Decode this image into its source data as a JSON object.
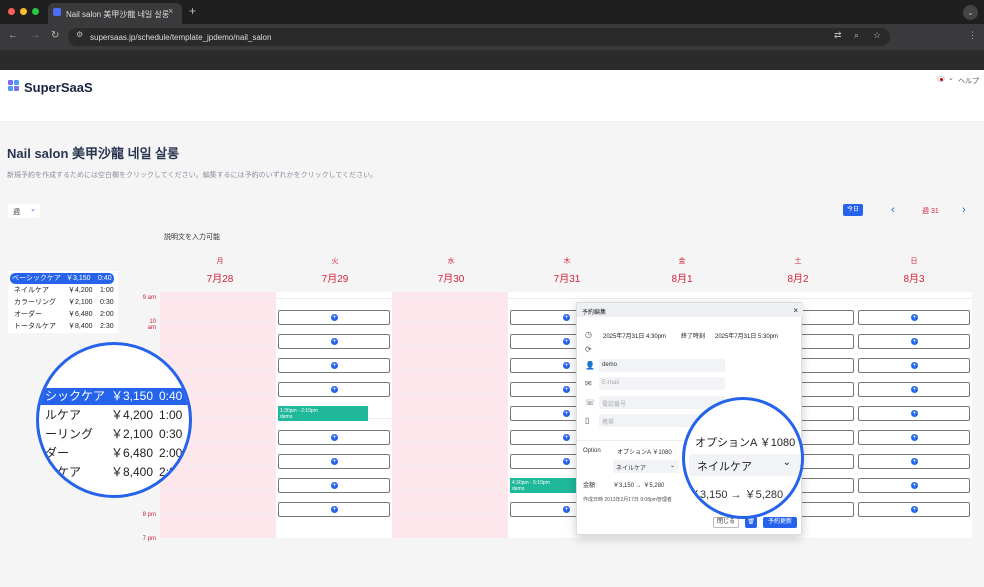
{
  "browser": {
    "tab_title": "Nail salon 美甲沙龍 네일 살롱",
    "tab_close": "×",
    "new_tab": "+",
    "url": "supersaas.jp/schedule/template_jpdemo/nail_salon",
    "menu": "⌄"
  },
  "header": {
    "brand": "SuperSaaS",
    "help": "ヘルプ"
  },
  "page": {
    "title": "Nail salon 美甲沙龍 네일 살롱",
    "subtitle": "新規予約を作成するためには空白欄をクリックしてください。編集するには予約のいずれかをクリックしてください。",
    "view": "週",
    "today": "今日",
    "week": "週 31",
    "desc_label": "説明文を入力可能"
  },
  "days": [
    {
      "name": "月",
      "date": "7月28"
    },
    {
      "name": "火",
      "date": "7月29"
    },
    {
      "name": "水",
      "date": "7月30"
    },
    {
      "name": "木",
      "date": "7月31"
    },
    {
      "name": "金",
      "date": "8月1"
    },
    {
      "name": "土",
      "date": "8月2"
    },
    {
      "name": "日",
      "date": "8月3"
    }
  ],
  "times": [
    "9 am",
    "10 am",
    "8 pm",
    "7 pm"
  ],
  "menu_list": [
    {
      "name": "ベーシックケア",
      "price": "￥3,150",
      "dur": "0:40"
    },
    {
      "name": "ネイルケア",
      "price": "￥4,200",
      "dur": "1:00"
    },
    {
      "name": "カラーリング",
      "price": "￥2,100",
      "dur": "0:30"
    },
    {
      "name": "オーダー",
      "price": "￥6,480",
      "dur": "2:00"
    },
    {
      "name": "トータルケア",
      "price": "￥8,400",
      "dur": "2:30"
    }
  ],
  "zoom_left": [
    {
      "name": "シックケア",
      "price": "￥3,150",
      "dur": "0:40"
    },
    {
      "name": "ルケア",
      "price": "￥4,200",
      "dur": "1:00"
    },
    {
      "name": "ーリング",
      "price": "￥2,100",
      "dur": "0:30"
    },
    {
      "name": "ダー",
      "price": "￥6,480",
      "dur": "2:00"
    },
    {
      "name": "ルケア",
      "price": "￥8,400",
      "dur": "2:30"
    }
  ],
  "bookings": [
    {
      "time": "1:30pm - 2:10pm",
      "note": "demo"
    },
    {
      "time": "4:30pm - 5:10pm",
      "note": "demo"
    }
  ],
  "dialog": {
    "title": "予約編集",
    "close": "×",
    "start": "2025年7月31日 4:30pm",
    "end_label": "終了時刻",
    "end": "2025年7月31日 5:30pm",
    "name": "demo",
    "email_placeholder": "E-mail",
    "phone_placeholder": "電話番号",
    "mobile_placeholder": "携帯",
    "option_label": "Option",
    "option_value": "オプションA ￥1080",
    "option_select": "ネイルケア",
    "amount_label": "金額",
    "amount": "￥3,150 → ￥5,280",
    "created": "作成日時 2013年2月17日 9:08pm管理者",
    "close_btn": "閉じる",
    "update_btn": "予約更新"
  },
  "zoom_right": {
    "option": "オプションA ￥1080",
    "select": "ネイルケア",
    "amount": "￥3,150 → ￥5,280"
  },
  "colors": {
    "accent": "#2563eb",
    "weekend_red": "#d0243a",
    "booking": "#1fb89a",
    "closed_day": "#fde7ec"
  }
}
